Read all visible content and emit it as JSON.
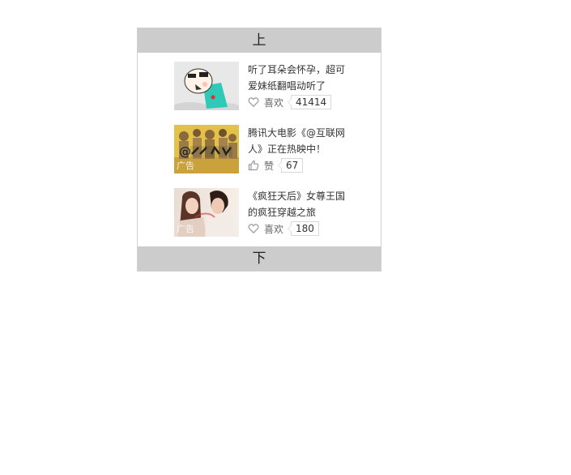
{
  "nav": {
    "up_label": "上",
    "down_label": "下"
  },
  "items": [
    {
      "title": "听了耳朵会怀孕，超可爱妹纸翻唱动听了",
      "action_label": "喜欢",
      "action_icon": "heart-icon",
      "count": "41414"
    },
    {
      "title": "腾讯大电影《@互联网人》正在热映中！",
      "action_label": "赞",
      "action_icon": "thumbs-up-icon",
      "count": "67",
      "ad_label": "广告"
    },
    {
      "title": "《疯狂天后》女尊王国的疯狂穿越之旅",
      "action_label": "喜欢",
      "action_icon": "heart-icon",
      "count": "180",
      "ad_label": "广告"
    }
  ],
  "colors": {
    "nav_bg": "#cccccc",
    "border": "#d0d0d0",
    "text": "#333333"
  }
}
